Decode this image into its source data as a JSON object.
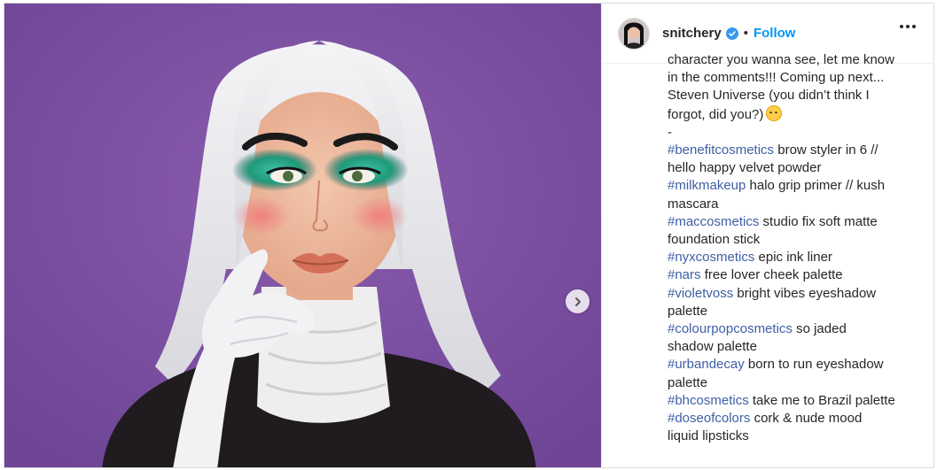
{
  "post": {
    "username": "snitchery",
    "dot": "•",
    "follow_label": "Follow",
    "more_icon": "more-options-icon",
    "next_icon": "chevron-right-icon",
    "verified_icon": "verified-badge-icon"
  },
  "caption": {
    "lines": [
      {
        "text": "character you wanna see, let me know"
      },
      {
        "text": "in the comments!!! Coming up next..."
      },
      {
        "text": "Steven Universe (you didn’t think I"
      },
      {
        "text": "forgot, did you?)",
        "emoji": "smiling-face-with-halo"
      },
      {
        "text": "-"
      },
      {
        "tag": "#benefitcosmetics",
        "text": " brow styler in 6 //"
      },
      {
        "text": "hello happy velvet powder"
      },
      {
        "tag": "#milkmakeup",
        "text": " halo grip primer // kush"
      },
      {
        "text": "mascara"
      },
      {
        "tag": "#maccosmetics",
        "text": " studio fix soft matte"
      },
      {
        "text": "foundation stick"
      },
      {
        "tag": "#nyxcosmetics",
        "text": " epic ink liner"
      },
      {
        "tag": "#nars",
        "text": " free lover cheek palette"
      },
      {
        "tag": "#violetvoss",
        "text": " bright vibes eyeshadow"
      },
      {
        "text": "palette"
      },
      {
        "tag": "#colourpopcosmetics",
        "text": " so jaded"
      },
      {
        "text": "shadow palette"
      },
      {
        "tag": "#urbandecay",
        "text": " born to run eyeshadow"
      },
      {
        "text": "palette"
      },
      {
        "tag": "#bhcosmetics",
        "text": " take me to Brazil palette"
      },
      {
        "tag": "#doseofcolors",
        "text": " cork & nude mood"
      },
      {
        "text": "liquid lipsticks"
      }
    ]
  },
  "colors": {
    "background_purple": "#7b4f9e",
    "hashtag": "#3e5fa4",
    "follow": "#0095f6",
    "verified": "#3897f0"
  }
}
